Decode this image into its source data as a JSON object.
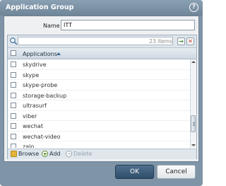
{
  "dialog": {
    "title": "Application Group"
  },
  "form": {
    "name_label": "Name",
    "name_value": "ITT"
  },
  "grid": {
    "items_count": "23 items",
    "column_header": "Applications",
    "rows": [
      {
        "label": "skydrive"
      },
      {
        "label": "skype"
      },
      {
        "label": "skype-probe"
      },
      {
        "label": "storage-backup"
      },
      {
        "label": "ultrasurf"
      },
      {
        "label": "viber"
      },
      {
        "label": "wechat"
      },
      {
        "label": "wechat-video"
      },
      {
        "label": "zalo"
      }
    ]
  },
  "toolbar": {
    "browse_label": "Browse",
    "add_label": "Add",
    "delete_label": "Delete"
  },
  "buttons": {
    "ok_label": "OK",
    "cancel_label": "Cancel"
  },
  "icons": {
    "help": "help-icon",
    "search": "search-icon",
    "go": "go-arrow-icon",
    "clear": "clear-x-icon",
    "browse": "folder-icon",
    "add": "plus-icon",
    "delete": "minus-icon"
  },
  "colors": {
    "title_bar": "#7f95a7",
    "ok_button": "#3a5a78",
    "clear_button": "#c0392b",
    "go_button": "#2b8c2b"
  }
}
